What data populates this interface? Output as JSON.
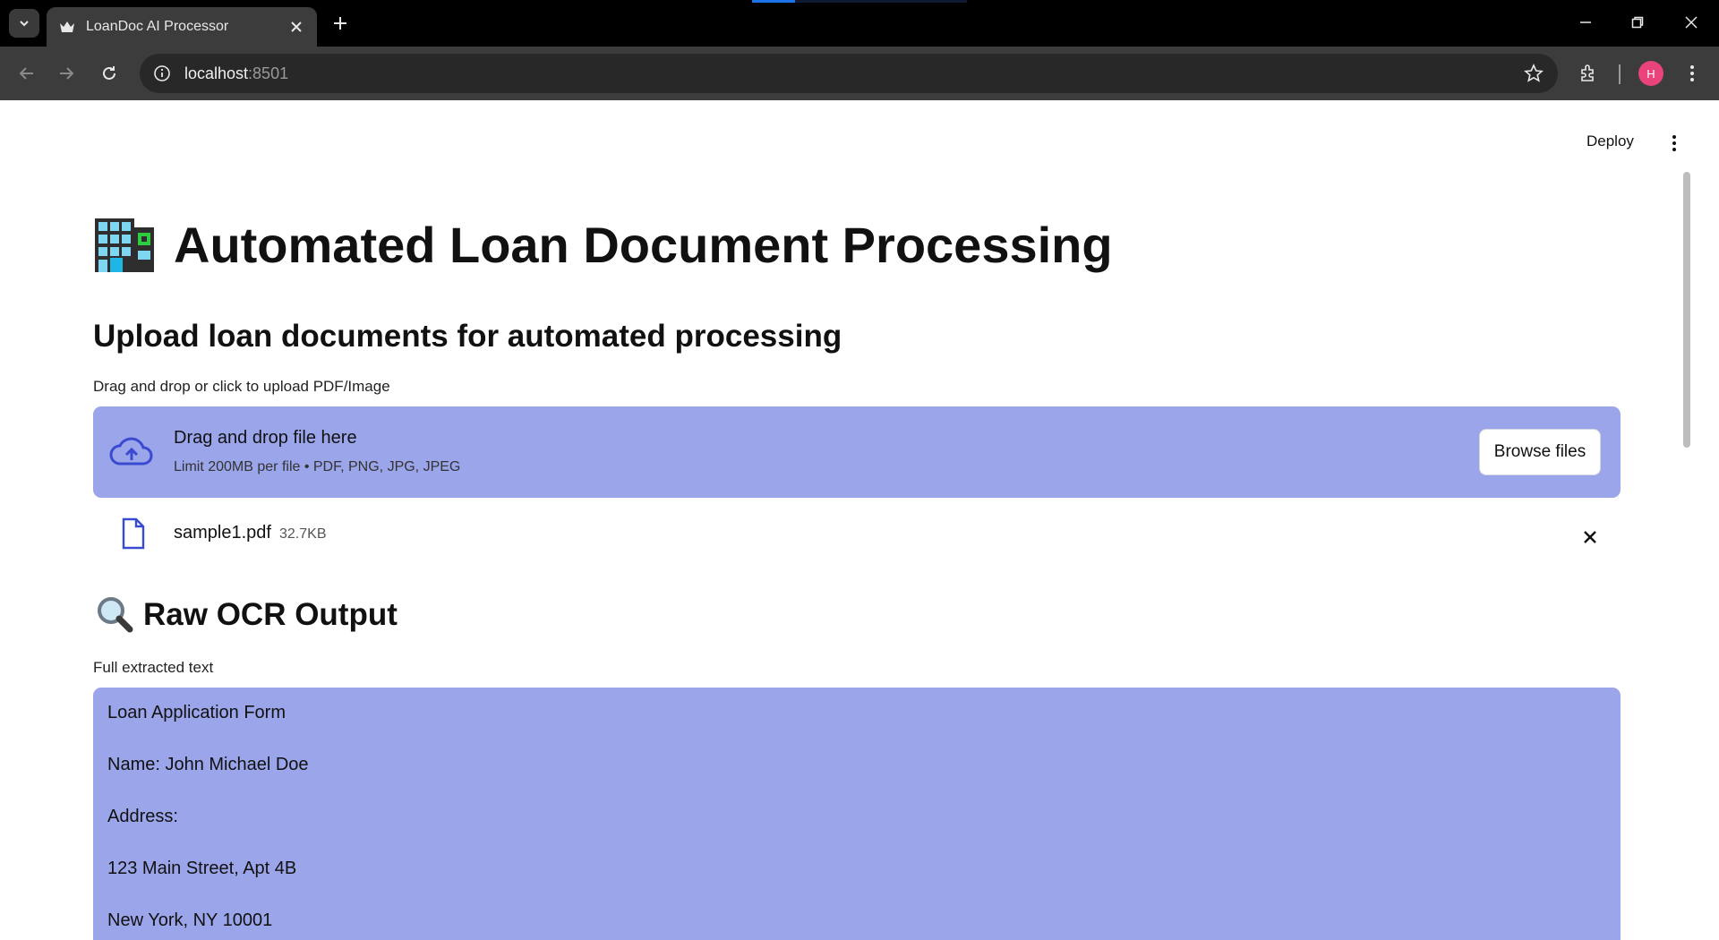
{
  "browser": {
    "tab_title": "LoanDoc AI Processor",
    "url_host": "localhost",
    "url_port": ":8501",
    "profile_initial": "H"
  },
  "header": {
    "deploy_label": "Deploy"
  },
  "main": {
    "title": "Automated Loan Document Processing",
    "subtitle": "Upload loan documents for automated processing",
    "uploader": {
      "label": "Drag and drop or click to upload PDF/Image",
      "dropzone_text": "Drag and drop file here",
      "limit_text": "Limit 200MB per file • PDF, PNG, JPG, JPEG",
      "browse_label": "Browse files"
    },
    "uploaded_file": {
      "name": "sample1.pdf",
      "size": "32.7KB"
    },
    "ocr": {
      "heading": "Raw OCR Output",
      "label": "Full extracted text",
      "lines": [
        "Loan Application Form",
        "Name: John Michael Doe",
        "Address:",
        "123 Main Street, Apt 4B",
        "New York, NY 10001"
      ]
    }
  },
  "colors": {
    "accent_area": "#9ba5ea",
    "profile": "#e8437a"
  },
  "icons": [
    "chevron-down-icon",
    "crown-icon",
    "close-icon",
    "plus-icon",
    "back-icon",
    "forward-icon",
    "reload-icon",
    "info-icon",
    "star-icon",
    "extensions-icon",
    "more-vert-icon",
    "building-icon",
    "cloud-upload-icon",
    "file-icon",
    "magnifier-icon"
  ]
}
